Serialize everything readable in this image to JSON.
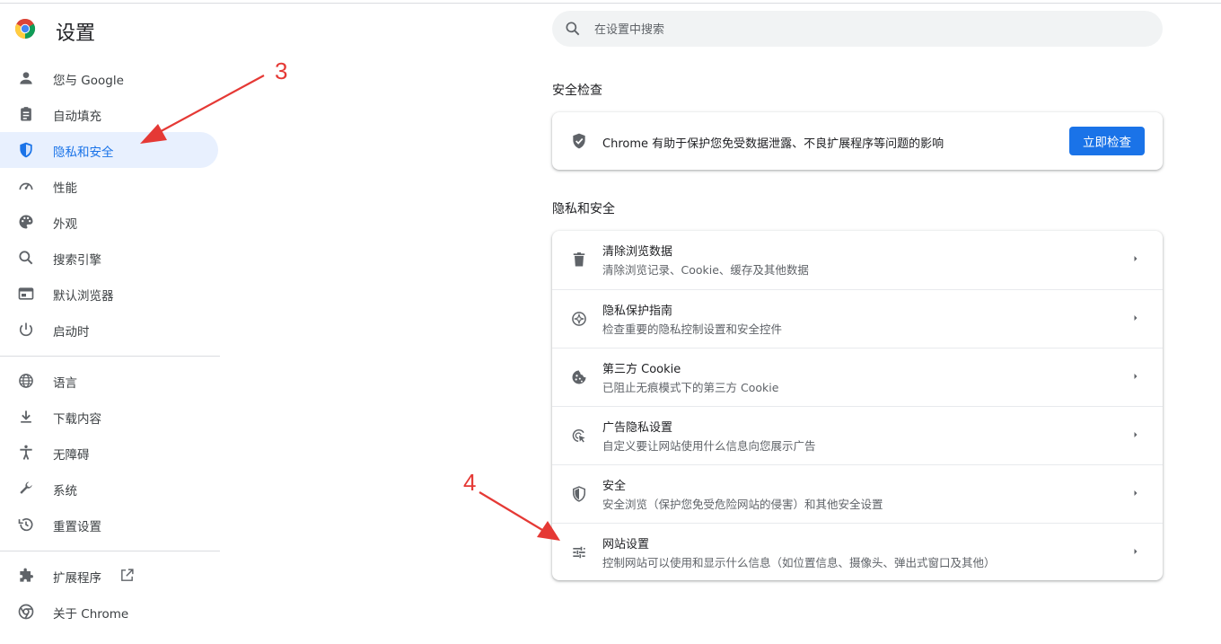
{
  "app": {
    "title": "设置"
  },
  "search": {
    "placeholder": "在设置中搜索"
  },
  "sidebar": {
    "items": [
      {
        "label": "您与 Google",
        "icon": "person-icon"
      },
      {
        "label": "自动填充",
        "icon": "clipboard-icon"
      },
      {
        "label": "隐私和安全",
        "icon": "shield-icon",
        "active": true
      },
      {
        "label": "性能",
        "icon": "speedometer-icon"
      },
      {
        "label": "外观",
        "icon": "palette-icon"
      },
      {
        "label": "搜索引擎",
        "icon": "search-icon"
      },
      {
        "label": "默认浏览器",
        "icon": "browser-window-icon"
      },
      {
        "label": "启动时",
        "icon": "power-icon"
      },
      {
        "label": "语言",
        "icon": "globe-icon"
      },
      {
        "label": "下载内容",
        "icon": "download-icon"
      },
      {
        "label": "无障碍",
        "icon": "accessibility-icon"
      },
      {
        "label": "系统",
        "icon": "wrench-icon"
      },
      {
        "label": "重置设置",
        "icon": "history-icon"
      },
      {
        "label": "扩展程序",
        "icon": "puzzle-icon"
      },
      {
        "label": "关于 Chrome",
        "icon": "chrome-icon"
      }
    ]
  },
  "safety_check": {
    "title": "安全检查",
    "description": "Chrome 有助于保护您免受数据泄露、不良扩展程序等问题的影响",
    "button": "立即检查"
  },
  "privacy": {
    "title": "隐私和安全",
    "rows": [
      {
        "title": "清除浏览数据",
        "subtitle": "清除浏览记录、Cookie、缓存及其他数据",
        "icon": "trash-icon"
      },
      {
        "title": "隐私保护指南",
        "subtitle": "检查重要的隐私控制设置和安全控件",
        "icon": "compass-icon"
      },
      {
        "title": "第三方 Cookie",
        "subtitle": "已阻止无痕模式下的第三方 Cookie",
        "icon": "cookie-icon"
      },
      {
        "title": "广告隐私设置",
        "subtitle": "自定义要让网站使用什么信息向您展示广告",
        "icon": "ad-privacy-icon"
      },
      {
        "title": "安全",
        "subtitle": "安全浏览（保护您免受危险网站的侵害）和其他安全设置",
        "icon": "security-shield-icon"
      },
      {
        "title": "网站设置",
        "subtitle": "控制网站可以使用和显示什么信息（如位置信息、摄像头、弹出式窗口及其他）",
        "icon": "tune-icon"
      }
    ]
  },
  "annotations": [
    "3",
    "4"
  ],
  "colors": {
    "accent": "#1a73e8",
    "active_bg": "#e8f0fe",
    "annotation": "#e53935"
  }
}
